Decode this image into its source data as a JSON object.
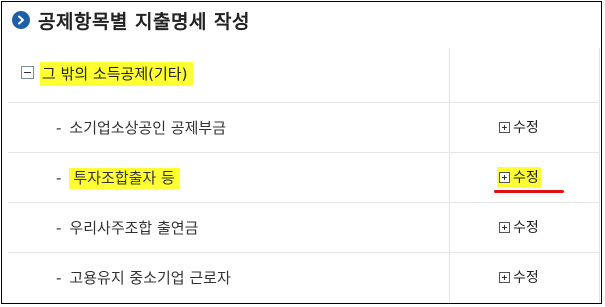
{
  "header": {
    "title": "공제항목별 지출명세 작성",
    "icon": "circle-arrow-right-icon",
    "icon_color": "#1f5fa8"
  },
  "group": {
    "label": "그 밖의 소득공제(기타)",
    "toggle_icon": "collapse-minus-icon",
    "highlight_color": "#ffff33"
  },
  "items": [
    {
      "label": "소기업소상공인 공제부금",
      "action": "수정"
    },
    {
      "label": "투자조합출자 등",
      "action": "수정"
    },
    {
      "label": "우리사주조합 출연금",
      "action": "수정"
    },
    {
      "label": "고용유지 중소기업 근로자",
      "action": "수정"
    }
  ],
  "dash": "-",
  "annotation_color": "#e01010"
}
